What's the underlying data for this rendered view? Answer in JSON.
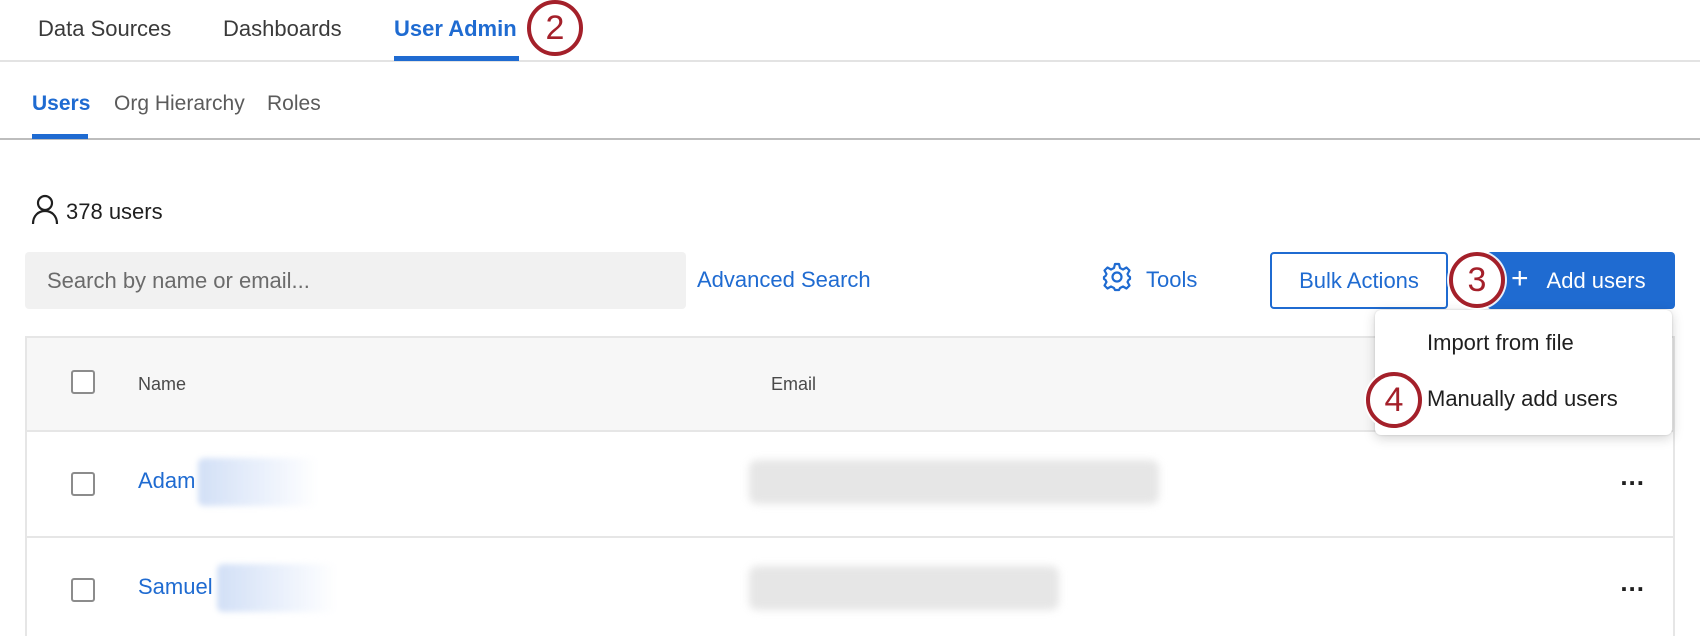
{
  "top_nav": {
    "tabs": [
      {
        "label": "Data Sources"
      },
      {
        "label": "Dashboards"
      },
      {
        "label": "User Admin",
        "active": true
      }
    ]
  },
  "sub_nav": {
    "tabs": [
      {
        "label": "Users",
        "active": true
      },
      {
        "label": "Org Hierarchy"
      },
      {
        "label": "Roles"
      }
    ]
  },
  "annotations": [
    "2",
    "3",
    "4"
  ],
  "user_count": {
    "icon": "user-icon",
    "text": "378 users"
  },
  "toolbar": {
    "search_placeholder": "Search by name or email...",
    "advanced_search": "Advanced Search",
    "tools_icon": "gear-icon",
    "tools": "Tools",
    "bulk_actions": "Bulk Actions",
    "add_icon": "plus-icon",
    "add_users": "Add users"
  },
  "dropdown": {
    "items": [
      "Import from file",
      "Manually add users"
    ]
  },
  "table": {
    "columns": [
      "Name",
      "Email"
    ],
    "rows": [
      {
        "name": "Adam"
      },
      {
        "name": "Samuel"
      }
    ],
    "row_menu_icon": "more-horizontal-icon",
    "row_menu_label": "..."
  },
  "colors": {
    "accent": "#1f6bd1",
    "annotation": "#a4202a"
  }
}
